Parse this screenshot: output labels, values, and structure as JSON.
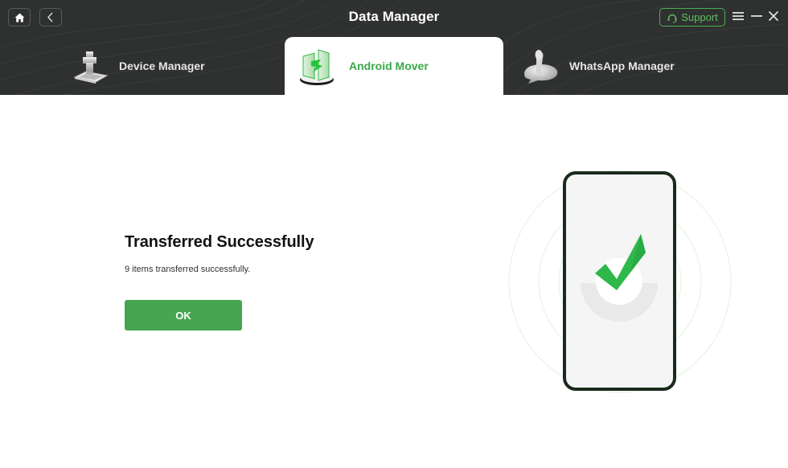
{
  "window": {
    "title": "Data Manager",
    "support_label": "Support",
    "colors": {
      "header_bg": "#2f3030",
      "accent_green": "#45a550",
      "support_green": "#5cbf62"
    }
  },
  "nav": {
    "home_icon": "home-icon",
    "back_icon": "chevron-left-icon"
  },
  "window_controls": {
    "menu_icon": "hamburger-menu-icon",
    "minimize_icon": "minimize-icon",
    "close_icon": "close-icon"
  },
  "tabs": [
    {
      "label": "Device Manager",
      "icon": "device-manager-icon",
      "active": false
    },
    {
      "label": "Android Mover",
      "icon": "android-mover-icon",
      "active": true
    },
    {
      "label": "WhatsApp Manager",
      "icon": "whatsapp-manager-icon",
      "active": false
    }
  ],
  "result": {
    "title": "Transferred Successfully",
    "description": "9 items transferred successfully.",
    "ok_label": "OK",
    "illustration_icon": "phone-success-checkmark-icon"
  }
}
